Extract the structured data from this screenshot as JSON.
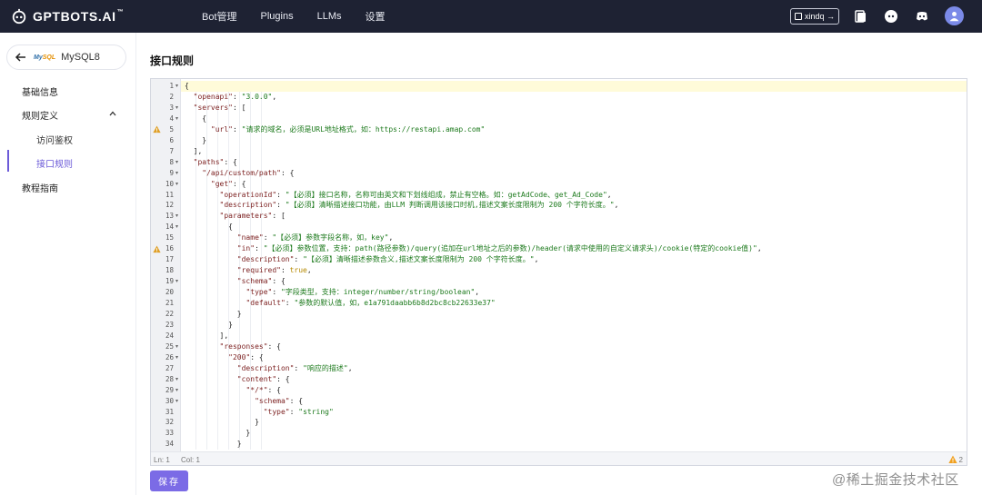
{
  "brand": {
    "name": "GPTBOTS.AI",
    "tm": "™"
  },
  "nav": [
    {
      "label": "Bot管理"
    },
    {
      "label": "Plugins"
    },
    {
      "label": "LLMs"
    },
    {
      "label": "设置"
    }
  ],
  "user_chip": {
    "label": "xindq →"
  },
  "topbar_icons": [
    "document-icon",
    "discord-alt-icon",
    "discord-icon"
  ],
  "sidebar": {
    "plugin_name": "MySQL8",
    "logo_text_a": "My",
    "logo_text_b": "SQL",
    "items": [
      {
        "label": "基础信息"
      },
      {
        "label": "规则定义"
      },
      {
        "label": "访问鉴权"
      },
      {
        "label": "接口规则"
      },
      {
        "label": "教程指南"
      }
    ]
  },
  "main": {
    "title": "接口规则",
    "status_pos": "Ln: 1",
    "status_col": "Col: 1",
    "warning_count": "2",
    "save_label": "保存"
  },
  "watermark": "@稀土掘金技术社区",
  "colors": {
    "accent": "#6c5bd8",
    "topbar": "#1e2233",
    "string": "#1d7a1d",
    "key": "#7b1f1f",
    "bool": "#b58900"
  },
  "code_lines": [
    {
      "n": "1",
      "fold": true,
      "parts": [
        [
          "p",
          "{"
        ]
      ]
    },
    {
      "n": "2",
      "parts": [
        [
          "p",
          "  "
        ],
        [
          "k",
          "\"openapi\""
        ],
        [
          "p",
          ": "
        ],
        [
          "s",
          "\"3.0.0\""
        ],
        [
          "p",
          ","
        ]
      ]
    },
    {
      "n": "3",
      "fold": true,
      "parts": [
        [
          "p",
          "  "
        ],
        [
          "k",
          "\"servers\""
        ],
        [
          "p",
          ": ["
        ]
      ]
    },
    {
      "n": "4",
      "fold": true,
      "parts": [
        [
          "p",
          "    {"
        ]
      ]
    },
    {
      "n": "5",
      "warn": true,
      "parts": [
        [
          "p",
          "      "
        ],
        [
          "k",
          "\"url\""
        ],
        [
          "p",
          ": "
        ],
        [
          "s",
          "\"请求的域名，必须是URL地址格式，如：https://restapi.amap.com\""
        ]
      ]
    },
    {
      "n": "6",
      "parts": [
        [
          "p",
          "    }"
        ]
      ]
    },
    {
      "n": "7",
      "parts": [
        [
          "p",
          "  ],"
        ]
      ]
    },
    {
      "n": "8",
      "fold": true,
      "parts": [
        [
          "p",
          "  "
        ],
        [
          "k",
          "\"paths\""
        ],
        [
          "p",
          ": {"
        ]
      ]
    },
    {
      "n": "9",
      "fold": true,
      "parts": [
        [
          "p",
          "    "
        ],
        [
          "k",
          "\"/api/custom/path\""
        ],
        [
          "p",
          ": {"
        ]
      ]
    },
    {
      "n": "10",
      "fold": true,
      "parts": [
        [
          "p",
          "      "
        ],
        [
          "k",
          "\"get\""
        ],
        [
          "p",
          ": {"
        ]
      ]
    },
    {
      "n": "11",
      "parts": [
        [
          "p",
          "        "
        ],
        [
          "k",
          "\"operationId\""
        ],
        [
          "p",
          ": "
        ],
        [
          "s",
          "\"【必须】接口名称，名称可由英文和下划线组成，禁止有空格。如：getAdCode、get_Ad_Code\""
        ],
        [
          "p",
          ","
        ]
      ]
    },
    {
      "n": "12",
      "parts": [
        [
          "p",
          "        "
        ],
        [
          "k",
          "\"description\""
        ],
        [
          "p",
          ": "
        ],
        [
          "s",
          "\"【必须】清晰描述接口功能，由LLM 判断调用该接口时机,描述文案长度限制为 200 个字符长度。\""
        ],
        [
          "p",
          ","
        ]
      ]
    },
    {
      "n": "13",
      "fold": true,
      "parts": [
        [
          "p",
          "        "
        ],
        [
          "k",
          "\"parameters\""
        ],
        [
          "p",
          ": ["
        ]
      ]
    },
    {
      "n": "14",
      "fold": true,
      "parts": [
        [
          "p",
          "          {"
        ]
      ]
    },
    {
      "n": "15",
      "parts": [
        [
          "p",
          "            "
        ],
        [
          "k",
          "\"name\""
        ],
        [
          "p",
          ": "
        ],
        [
          "s",
          "\"【必须】参数字段名称，如，key\""
        ],
        [
          "p",
          ","
        ]
      ]
    },
    {
      "n": "16",
      "warn": true,
      "parts": [
        [
          "p",
          "            "
        ],
        [
          "k",
          "\"in\""
        ],
        [
          "p",
          ": "
        ],
        [
          "s",
          "\"【必须】参数位置，支持：path(路径参数)/query(追加在url地址之后的参数)/header(请求中使用的自定义请求头)/cookie(特定的cookie值)\""
        ],
        [
          "p",
          ","
        ]
      ]
    },
    {
      "n": "17",
      "parts": [
        [
          "p",
          "            "
        ],
        [
          "k",
          "\"description\""
        ],
        [
          "p",
          ": "
        ],
        [
          "s",
          "\"【必须】清晰描述参数含义,描述文案长度限制为 200 个字符长度。\""
        ],
        [
          "p",
          ","
        ]
      ]
    },
    {
      "n": "18",
      "parts": [
        [
          "p",
          "            "
        ],
        [
          "k",
          "\"required\""
        ],
        [
          "p",
          ": "
        ],
        [
          "b",
          "true"
        ],
        [
          "p",
          ","
        ]
      ]
    },
    {
      "n": "19",
      "fold": true,
      "parts": [
        [
          "p",
          "            "
        ],
        [
          "k",
          "\"schema\""
        ],
        [
          "p",
          ": {"
        ]
      ]
    },
    {
      "n": "20",
      "parts": [
        [
          "p",
          "              "
        ],
        [
          "k",
          "\"type\""
        ],
        [
          "p",
          ": "
        ],
        [
          "s",
          "\"字段类型，支持：integer/number/string/boolean\""
        ],
        [
          "p",
          ","
        ]
      ]
    },
    {
      "n": "21",
      "parts": [
        [
          "p",
          "              "
        ],
        [
          "k",
          "\"default\""
        ],
        [
          "p",
          ": "
        ],
        [
          "s",
          "\"参数的默认值，如，e1a791daabb6b8d2bc8cb22633e37\""
        ]
      ]
    },
    {
      "n": "22",
      "parts": [
        [
          "p",
          "            }"
        ]
      ]
    },
    {
      "n": "23",
      "parts": [
        [
          "p",
          "          }"
        ]
      ]
    },
    {
      "n": "24",
      "parts": [
        [
          "p",
          "        ],"
        ]
      ]
    },
    {
      "n": "25",
      "fold": true,
      "parts": [
        [
          "p",
          "        "
        ],
        [
          "k",
          "\"responses\""
        ],
        [
          "p",
          ": {"
        ]
      ]
    },
    {
      "n": "26",
      "fold": true,
      "parts": [
        [
          "p",
          "          "
        ],
        [
          "k",
          "\"200\""
        ],
        [
          "p",
          ": {"
        ]
      ]
    },
    {
      "n": "27",
      "parts": [
        [
          "p",
          "            "
        ],
        [
          "k",
          "\"description\""
        ],
        [
          "p",
          ": "
        ],
        [
          "s",
          "\"响应的描述\""
        ],
        [
          "p",
          ","
        ]
      ]
    },
    {
      "n": "28",
      "fold": true,
      "parts": [
        [
          "p",
          "            "
        ],
        [
          "k",
          "\"content\""
        ],
        [
          "p",
          ": {"
        ]
      ]
    },
    {
      "n": "29",
      "fold": true,
      "parts": [
        [
          "p",
          "              "
        ],
        [
          "k",
          "\"*/*\""
        ],
        [
          "p",
          ": {"
        ]
      ]
    },
    {
      "n": "30",
      "fold": true,
      "parts": [
        [
          "p",
          "                "
        ],
        [
          "k",
          "\"schema\""
        ],
        [
          "p",
          ": {"
        ]
      ]
    },
    {
      "n": "31",
      "parts": [
        [
          "p",
          "                  "
        ],
        [
          "k",
          "\"type\""
        ],
        [
          "p",
          ": "
        ],
        [
          "s",
          "\"string\""
        ]
      ]
    },
    {
      "n": "32",
      "parts": [
        [
          "p",
          "                }"
        ]
      ]
    },
    {
      "n": "33",
      "parts": [
        [
          "p",
          "              }"
        ]
      ]
    },
    {
      "n": "34",
      "parts": [
        [
          "p",
          "            }"
        ]
      ]
    }
  ]
}
